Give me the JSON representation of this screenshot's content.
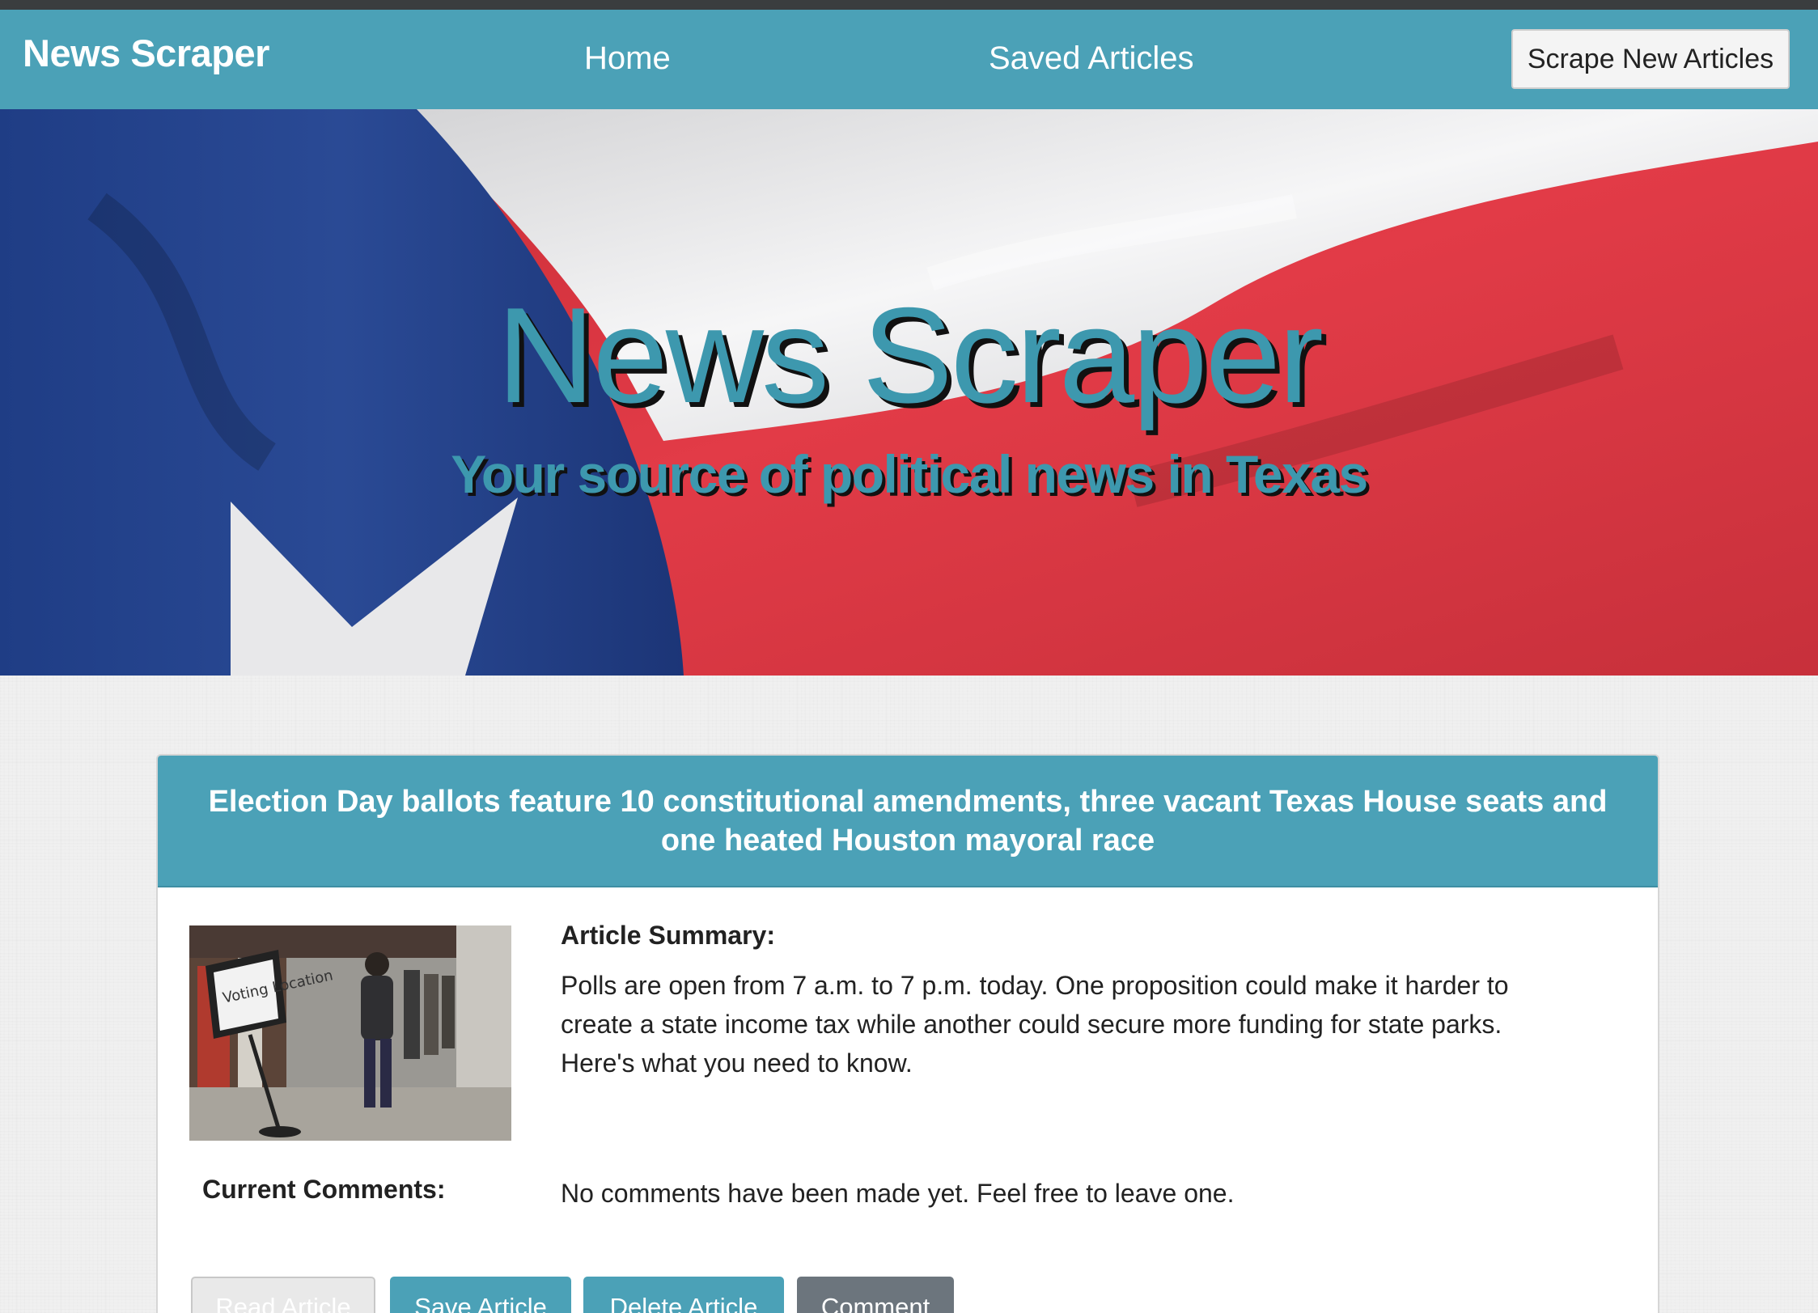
{
  "nav": {
    "brand": "News Scraper",
    "links": [
      {
        "label": "Home"
      },
      {
        "label": "Saved Articles"
      }
    ],
    "scrape_button": "Scrape New Articles"
  },
  "hero": {
    "title": "News Scraper",
    "subtitle": "Your source of political news in Texas"
  },
  "article": {
    "title": "Election Day ballots feature 10 constitutional amendments, three vacant Texas House seats and one heated Houston mayoral race",
    "summary_label": "Article Summary:",
    "summary": "Polls are open from 7 a.m. to 7 p.m. today. One proposition could make it harder to create a state income tax while another could secure more funding for state parks. Here's what you need to know.",
    "comments_label": "Current Comments:",
    "comments_text": "No comments have been made yet. Feel free to leave one.",
    "image_sign_text": "Voting Location",
    "buttons": {
      "read": "Read Article",
      "save": "Save Article",
      "delete": "Delete Article",
      "comment": "Comment"
    }
  },
  "colors": {
    "primary": "#4ba1b7",
    "secondary": "#6c757d",
    "flag_blue": "#22408a",
    "flag_red": "#d7333f",
    "flag_white": "#eeeeee"
  }
}
